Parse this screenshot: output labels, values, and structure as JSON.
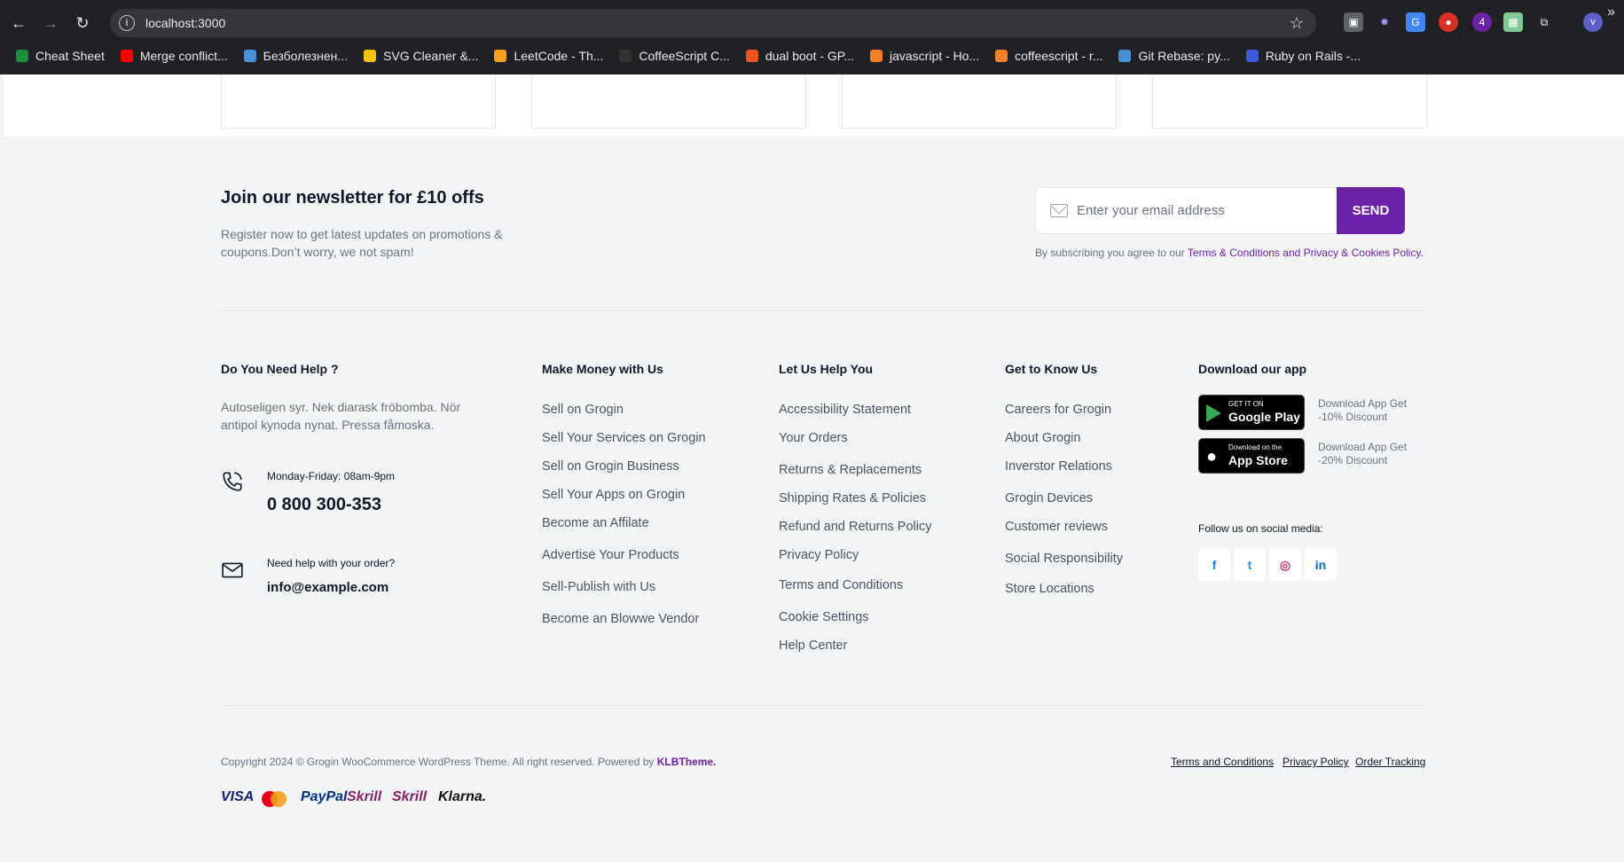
{
  "browser": {
    "url": "localhost:3000",
    "extension_badge": "4",
    "profile_initial": "v",
    "bookmarks": [
      {
        "label": "Cheat Sheet",
        "icon": "shield-icon",
        "color": "#1e8e3e"
      },
      {
        "label": "Merge conflict...",
        "icon": "youtube-icon",
        "color": "#ff0000"
      },
      {
        "label": "Безболезнен...",
        "icon": "gear-icon",
        "color": "#4a90d9"
      },
      {
        "label": "SVG Cleaner &...",
        "icon": "warning-icon",
        "color": "#f4c20d"
      },
      {
        "label": "LeetCode - Th...",
        "icon": "leetcode-icon",
        "color": "#f89f1b"
      },
      {
        "label": "CoffeeScript C...",
        "icon": "book-icon",
        "color": "#333333"
      },
      {
        "label": "dual boot - GP...",
        "icon": "askubuntu-icon",
        "color": "#e95420"
      },
      {
        "label": "javascript - Ho...",
        "icon": "stackoverflow-icon",
        "color": "#f48024"
      },
      {
        "label": "coffeescript - r...",
        "icon": "stackoverflow-icon",
        "color": "#f48024"
      },
      {
        "label": "Git Rebase: py...",
        "icon": "gear-icon",
        "color": "#4a90d9"
      },
      {
        "label": "Ruby on Rails -...",
        "icon": "cl-icon",
        "color": "#3b5bdb"
      }
    ]
  },
  "newsletter": {
    "title": "Join our newsletter for £10 offs",
    "description": "Register now to get latest updates on promotions & coupons.Don’t worry, we not spam!",
    "placeholder": "Enter your email address",
    "send_label": "SEND",
    "agree_prefix": "By subscribing you agree to our ",
    "agree_link": "Terms & Conditions and Privacy & Cookies Policy."
  },
  "help": {
    "heading": "Do You Need Help ?",
    "description": "Autoseligen syr. Nek diarask fröbomba. Nör antipol kynoda nynat. Pressa fåmoska.",
    "phone_hours": "Monday-Friday: 08am-9pm",
    "phone": "0 800 300-353",
    "email_label": "Need help with your order?",
    "email": "info@example.com"
  },
  "columns": {
    "money": {
      "heading": "Make Money with Us",
      "links": [
        "Sell on Grogin",
        "Sell Your Services on Grogin",
        "Sell on Grogin Business",
        "Sell Your Apps on Grogin",
        "Become an Affilate",
        "Advertise Your Products",
        "Sell-Publish with Us",
        "Become an Blowwe Vendor"
      ]
    },
    "help_you": {
      "heading": "Let Us Help You",
      "links": [
        "Accessibility Statement",
        "Your Orders",
        "Returns & Replacements",
        "Shipping Rates & Policies",
        "Refund and Returns Policy",
        "Privacy Policy",
        "Terms and Conditions",
        "Cookie Settings",
        "Help Center"
      ]
    },
    "know_us": {
      "heading": "Get to Know Us",
      "links": [
        "Careers for Grogin",
        "About Grogin",
        "Inverstor Relations",
        "Grogin Devices",
        "Customer reviews",
        "Social Responsibility",
        "Store Locations"
      ]
    }
  },
  "app": {
    "heading": "Download our app",
    "google_small": "GET IT ON",
    "google_big": "Google Play",
    "google_note": "Download App Get -10% Discount",
    "apple_small": "Download on the",
    "apple_big": "App Store",
    "apple_note": "Download App Get -20% Discount",
    "follow": "Follow us on social media:",
    "social": [
      {
        "glyph": "f",
        "icon": "facebook-icon",
        "color": "#1877f2"
      },
      {
        "glyph": "t",
        "icon": "twitter-icon",
        "color": "#1d9bf0"
      },
      {
        "glyph": "◎",
        "icon": "instagram-icon",
        "color": "#e1306c"
      },
      {
        "glyph": "in",
        "icon": "linkedin-icon",
        "color": "#0a66c2"
      }
    ]
  },
  "footer": {
    "copyright": "Copyright 2024 © Grogin WooCommerce WordPress Theme. All right reserved. Powered by ",
    "brand": "KLBTheme.",
    "links": [
      "Terms and Conditions",
      "Privacy Policy",
      "Order Tracking"
    ],
    "payments": [
      {
        "label": "VISA",
        "color": "#1a1f71"
      },
      {
        "label": "PayPal",
        "color": "#003087"
      },
      {
        "label": "Skrill",
        "color": "#862165"
      },
      {
        "label": "Skrill",
        "color": "#862165"
      },
      {
        "label": "Klarna.",
        "color": "#111111"
      }
    ]
  }
}
